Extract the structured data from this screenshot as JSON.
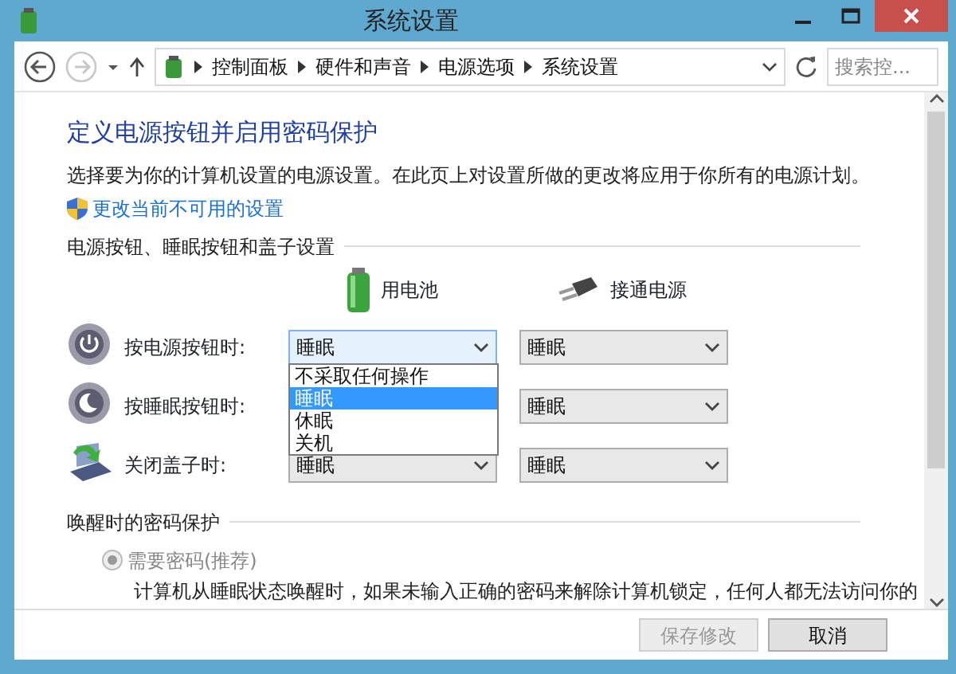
{
  "window": {
    "title": "系统设置"
  },
  "address_bar": {
    "crumbs": [
      "控制面板",
      "硬件和声音",
      "电源选项",
      "系统设置"
    ],
    "search_placeholder": "搜索控..."
  },
  "nav": {
    "back_disabled": false,
    "forward_disabled": true
  },
  "heading": "定义电源按钮并启用密码保护",
  "description": "选择要为你的计算机设置的电源设置。在此页上对设置所做的更改将应用于你所有的电源计划。",
  "shield_link": "更改当前不可用的设置",
  "buttons_section": {
    "title": "电源按钮、睡眠按钮和盖子设置",
    "columns": [
      {
        "kind": "battery",
        "label": "用电池"
      },
      {
        "kind": "plug",
        "label": "接通电源"
      }
    ],
    "rows": [
      {
        "kind": "power",
        "label": "按电源按钮时:",
        "battery": {
          "value": "睡眠",
          "disabled": false,
          "expanded": true,
          "options": [
            {
              "label": "不采取任何操作",
              "selected": false
            },
            {
              "label": "睡眠",
              "selected": true
            },
            {
              "label": "休眠",
              "selected": false
            },
            {
              "label": "关机",
              "selected": false
            }
          ]
        },
        "plugged": {
          "value": "睡眠",
          "disabled": true
        }
      },
      {
        "kind": "sleep",
        "label": "按睡眠按钮时:",
        "plugged": {
          "value": "睡眠",
          "disabled": true
        }
      },
      {
        "kind": "lid",
        "label": "关闭盖子时:",
        "battery": {
          "value": "睡眠",
          "disabled": true,
          "expanded": false
        },
        "plugged": {
          "value": "睡眠",
          "disabled": true
        }
      }
    ]
  },
  "password_section": {
    "title": "唤醒时的密码保护",
    "options": [
      {
        "label": "需要密码(推荐)",
        "selected": true,
        "disabled": true,
        "description": "计算机从睡眠状态唤醒时，如果未输入正确的密码来解除计算机锁定，任何人都无法访问你的"
      }
    ]
  },
  "footer_buttons": [
    {
      "label": "保存修改",
      "disabled": true
    },
    {
      "label": "取消",
      "disabled": false
    }
  ]
}
